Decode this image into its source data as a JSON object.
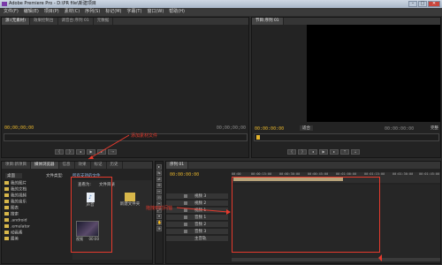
{
  "app": {
    "title": "Adobe Premiere Pro - D:\\PR file\\新建项目"
  },
  "menu": [
    "文件(F)",
    "编辑(E)",
    "项目(P)",
    "素材(C)",
    "序列(S)",
    "标记(M)",
    "字幕(T)",
    "窗口(W)",
    "帮助(H)"
  ],
  "source_panel": {
    "tabs": [
      "源:(无素材)",
      "效果控制台",
      "调音台:序列 01",
      "元数据"
    ],
    "timecode_left": "00;00;00;00",
    "timecode_right": "00;00;00;00"
  },
  "program_panel": {
    "tabs": [
      "节目:序列 01"
    ],
    "timecode_left": "00:00:00:00",
    "zoom": "适合",
    "timecode_right": "00:00:00:00",
    "full_label": "完整"
  },
  "annotations": {
    "add_media": "添加素材文件",
    "drag_media": "拖拽到时间轴"
  },
  "project_panel": {
    "tabs": [
      "项目:新项目",
      "媒体浏览器",
      "信息",
      "效果",
      "标记",
      "历史"
    ],
    "drive_label": "桌面",
    "filter_label": "文件类型:",
    "filter_value": "所有支持的文件",
    "view_label": "查看为:",
    "view_value": "文件目录",
    "tree": [
      "我的图片",
      "我的文档",
      "我的视频",
      "我的音乐",
      "图表",
      "搜索",
      ".android",
      ".emulator",
      "动画素",
      "最美"
    ],
    "files": [
      {
        "name": "声音",
        "type": "audio"
      },
      {
        "name": "新建文件夹",
        "type": "folder"
      },
      {
        "name": "视频",
        "type": "video",
        "duration": "00:00"
      }
    ]
  },
  "timeline_panel": {
    "tabs": [
      "序列 01"
    ],
    "timecode": "00:00:00:00",
    "ruler": [
      "00:00",
      "00:00:15:00",
      "00:00:30:00",
      "00:00:45:00",
      "00:01:00:00",
      "00:01:15:00",
      "00:01:30:00",
      "00:01:45:00"
    ],
    "tracks": [
      "视频 3",
      "视频 2",
      "视频 1",
      "音频 1",
      "音频 2",
      "音频 3",
      "主音轨"
    ],
    "tools": [
      "▸",
      "⇆",
      "⇄",
      "✣",
      "↔",
      "⊟",
      "✂",
      "⤢",
      "⌖",
      "✋",
      "🔍"
    ]
  },
  "colors": {
    "accent": "#e5b42c",
    "annotation": "#e53a2d",
    "clip": "#b8a37a"
  }
}
